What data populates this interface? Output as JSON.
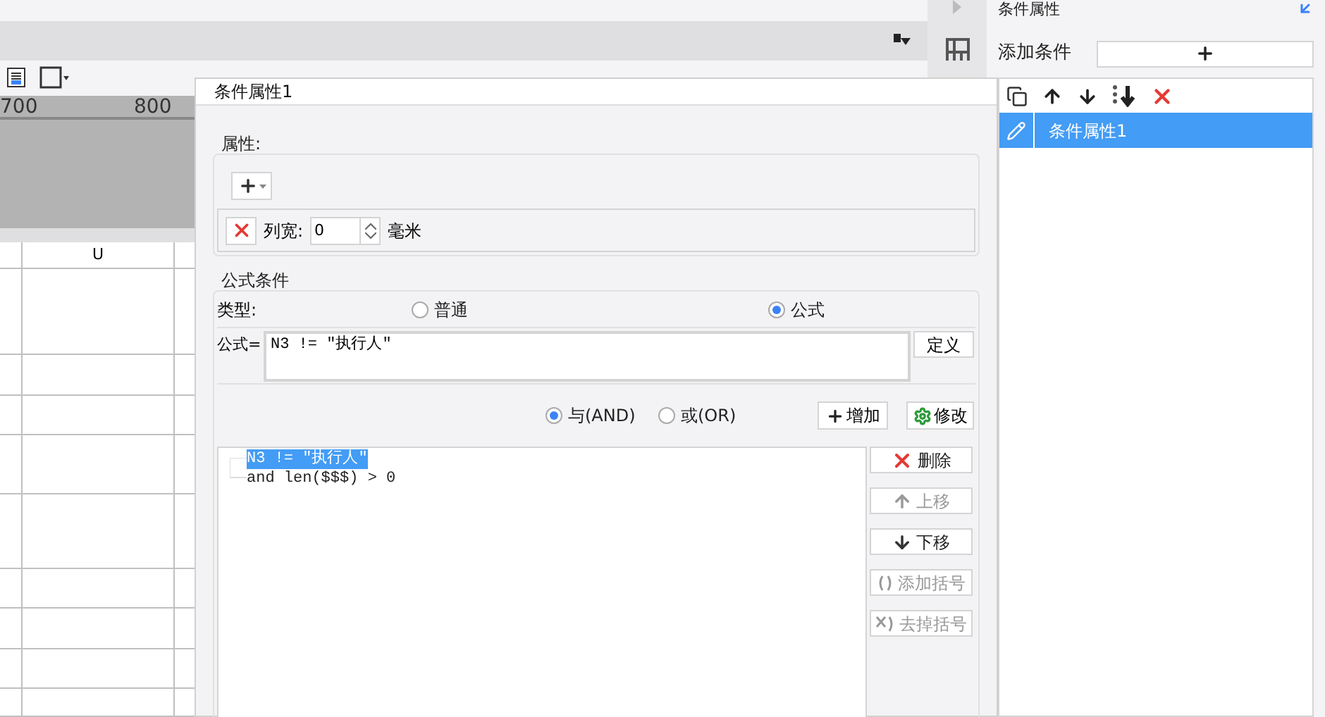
{
  "ruler": {
    "labels": [
      "700",
      "800"
    ]
  },
  "sheet": {
    "columns": [
      "U"
    ]
  },
  "dialog": {
    "title": "条件属性1",
    "properties": {
      "label": "属性:",
      "width_label": "列宽:",
      "width_value": "0",
      "unit": "毫米"
    },
    "formula_condition": {
      "label": "公式条件",
      "type_label": "类型:",
      "types": [
        {
          "label": "普通",
          "selected": false
        },
        {
          "label": "公式",
          "selected": true
        }
      ],
      "formula_label": "公式=",
      "formula": "N3 != \"执行人\"",
      "define_button": "定义",
      "joins": [
        {
          "label": "与(AND)",
          "selected": true
        },
        {
          "label": "或(OR)",
          "selected": false
        }
      ],
      "add_button": "增加",
      "modify_button": "修改",
      "conditions": [
        {
          "text": "N3 != \"执行人\"",
          "selected": true
        },
        {
          "text": "and len($$$) > 0",
          "selected": false
        }
      ],
      "side_buttons": [
        {
          "kind": "delete",
          "label": "删除",
          "disabled": false
        },
        {
          "kind": "up",
          "label": "上移",
          "disabled": true
        },
        {
          "kind": "down",
          "label": "下移",
          "disabled": false
        },
        {
          "kind": "add-paren",
          "label": "添加括号",
          "disabled": true
        },
        {
          "kind": "remove-paren",
          "label": "去掉括号",
          "disabled": true
        }
      ]
    }
  },
  "right_panel": {
    "title": "条件属性",
    "add_label": "添加条件",
    "items": [
      {
        "label": "条件属性1",
        "selected": true
      }
    ]
  }
}
